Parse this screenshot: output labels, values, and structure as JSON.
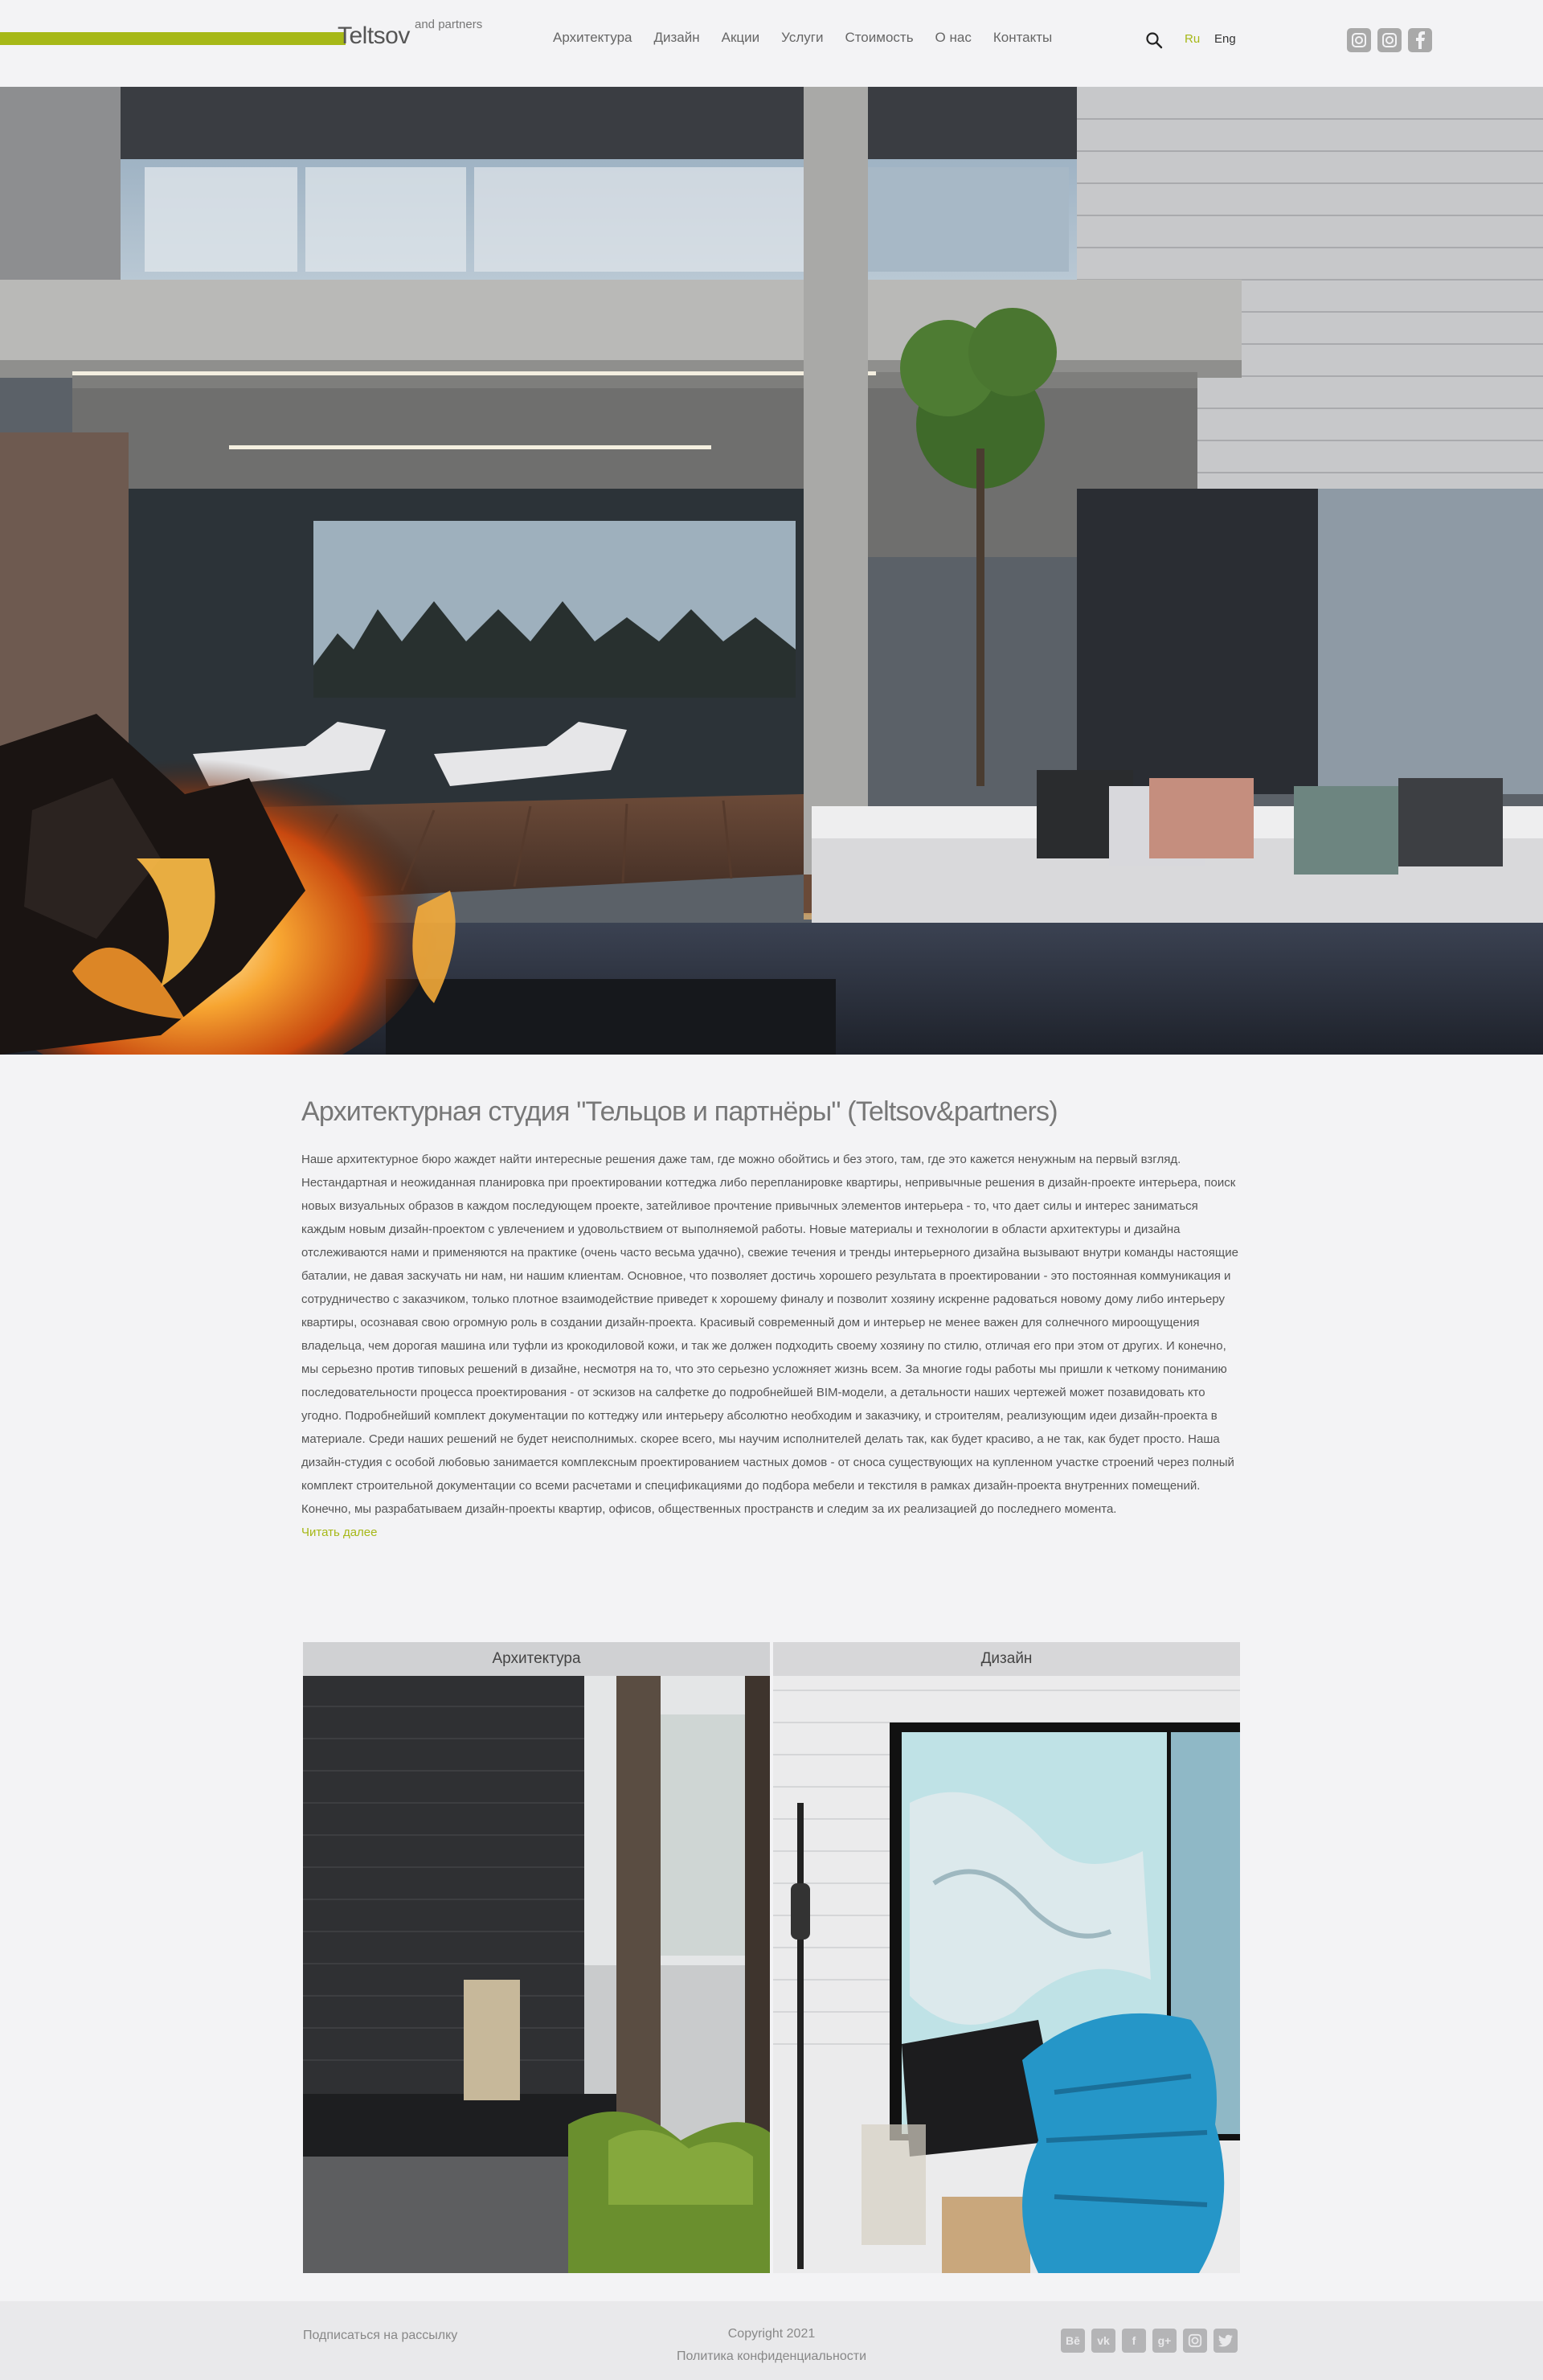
{
  "header": {
    "brand": "Teltsov",
    "brand_sub": "and partners",
    "nav": [
      "Архитектура",
      "Дизайн",
      "Акции",
      "Услуги",
      "Стоимость",
      "О нас",
      "Контакты"
    ],
    "lang_ru": "Ru",
    "lang_en": "Eng",
    "social_icons": [
      "instagram-icon",
      "instagram-icon",
      "facebook-icon"
    ]
  },
  "hero": {
    "image": "modern-house-terrace-with-fire-pit"
  },
  "main": {
    "title": "Архитектурная студия \"Тельцов и партнёры\" (Teltsov&partners)",
    "body": "Наше архитектурное бюро жаждет найти интересные решения даже там, где можно обойтись и без этого, там, где это кажется ненужным на первый взгляд. Нестандартная и неожиданная планировка при проектировании коттеджа либо перепланировке квартиры, непривычные решения в дизайн-проекте интерьера, поиск новых визуальных образов в каждом последующем проекте, затейливое прочтение привычных элементов интерьера - то, что дает силы и интерес заниматься каждым новым дизайн-проектом с увлечением и удовольствием от выполняемой работы. Новые материалы и технологии в области архитектуры и дизайна отслеживаются нами и применяются на практике (очень часто весьма удачно), свежие течения и тренды интерьерного дизайна вызывают внутри команды настоящие баталии, не давая заскучать ни нам, ни нашим клиентам. Основное, что позволяет достичь хорошего результата в проектировании - это постоянная коммуникация и сотрудничество с заказчиком, только плотное взаимодействие приведет к хорошему финалу и позволит хозяину искренне радоваться новому дому либо интерьеру квартиры, осознавая свою огромную роль в создании дизайн-проекта. Красивый современный дом и интерьер не менее важен для солнечного мироощущения владельца, чем дорогая машина или туфли из крокодиловой кожи, и так же должен подходить своему хозяину по стилю, отличая его при этом от других. И конечно, мы серьезно против типовых решений в дизайне, несмотря на то, что это серьезно усложняет жизнь всем. За многие годы работы мы пришли к четкому пониманию последовательности процесса проектирования - от эскизов на салфетке до подробнейшей BIM-модели, а детальности наших чертежей может позавидовать кто угодно. Подробнейший комплект документации по коттеджу или интерьеру абсолютно необходим и заказчику, и строителям, реализующим идеи дизайн-проекта в материале. Среди наших решений не будет неисполнимых. скорее всего, мы научим исполнителей делать так, как будет красиво, а не так, как будет просто. Наша дизайн-студия с особой любовью занимается комплексным проектированием частных домов - от сноса существующих на купленном участке строений через полный комплект строительной документации со всеми расчетами и спецификациями до подбора мебели и текстиля в рамках дизайн-проекта внутренних помещений. Конечно, мы разрабатываем дизайн-проекты квартир, офисов, общественных пространств и следим за их реализацией до последнего момента.",
    "read_more": "Читать далее"
  },
  "cards": [
    {
      "label": "Архитектура"
    },
    {
      "label": "Дизайн"
    }
  ],
  "footer": {
    "subscribe": "Подписаться на рассылку",
    "copyright": "Copyright 2021",
    "privacy": "Политика конфиденциальности",
    "social_icons": [
      "behance-icon",
      "vk-icon",
      "facebook-icon",
      "google-plus-icon",
      "instagram-icon",
      "twitter-icon"
    ]
  },
  "colors": {
    "accent": "#a6b817",
    "background": "#f3f3f5",
    "footer_bg": "#e9e9eb"
  }
}
